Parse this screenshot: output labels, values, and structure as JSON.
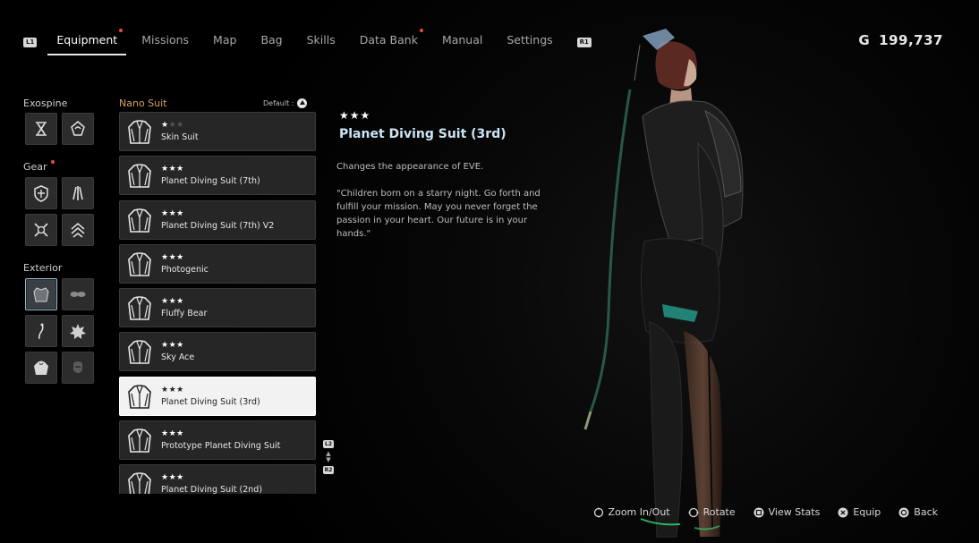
{
  "topbar": {
    "left_button": "L1",
    "right_button": "R1",
    "tabs": [
      {
        "label": "Equipment",
        "active": true,
        "notify": true
      },
      {
        "label": "Missions",
        "active": false,
        "notify": false
      },
      {
        "label": "Map",
        "active": false,
        "notify": false
      },
      {
        "label": "Bag",
        "active": false,
        "notify": false
      },
      {
        "label": "Skills",
        "active": false,
        "notify": false
      },
      {
        "label": "Data Bank",
        "active": false,
        "notify": true
      },
      {
        "label": "Manual",
        "active": false,
        "notify": false
      },
      {
        "label": "Settings",
        "active": false,
        "notify": false
      }
    ],
    "currency_symbol": "G",
    "currency_value": "199,737"
  },
  "sidebar": {
    "exospine_label": "Exospine",
    "gear_label": "Gear",
    "exterior_label": "Exterior",
    "exospine_slots": [
      "exospine-x-icon",
      "exospine-swirl-icon"
    ],
    "gear_slots": [
      "gear-shield-icon",
      "gear-claw-icon",
      "gear-cross-icon",
      "gear-chevron-icon"
    ],
    "exterior_slots": [
      "suit-jacket-icon",
      "glasses-icon",
      "earring-icon",
      "hair-ornament-icon",
      "hoodie-icon",
      "mask-icon"
    ]
  },
  "list": {
    "header": "Nano Suit",
    "default_label": "Default :",
    "items": [
      {
        "name": "Skin Suit",
        "stars": 1
      },
      {
        "name": "Planet Diving Suit (7th)",
        "stars": 3
      },
      {
        "name": "Planet Diving Suit (7th) V2",
        "stars": 3
      },
      {
        "name": "Photogenic",
        "stars": 3
      },
      {
        "name": "Fluffy Bear",
        "stars": 3
      },
      {
        "name": "Sky Ace",
        "stars": 3
      },
      {
        "name": "Planet Diving Suit (3rd)",
        "stars": 3,
        "selected": true
      },
      {
        "name": "Prototype Planet Diving Suit",
        "stars": 3
      },
      {
        "name": "Planet Diving Suit (2nd)",
        "stars": 3
      }
    ],
    "scroll_up_button": "L2",
    "scroll_down_button": "R2"
  },
  "detail": {
    "stars": "★★★",
    "title": "Planet Diving Suit (3rd)",
    "description": "Changes the appearance of EVE.",
    "quote": "\"Children born on a starry night. Go forth and fulfill your mission. May you never forget the passion in your heart. Our future is in your hands.\""
  },
  "hints": {
    "zoom": "Zoom In/Out",
    "rotate": "Rotate",
    "view_stats": "View Stats",
    "equip": "Equip",
    "back": "Back"
  }
}
